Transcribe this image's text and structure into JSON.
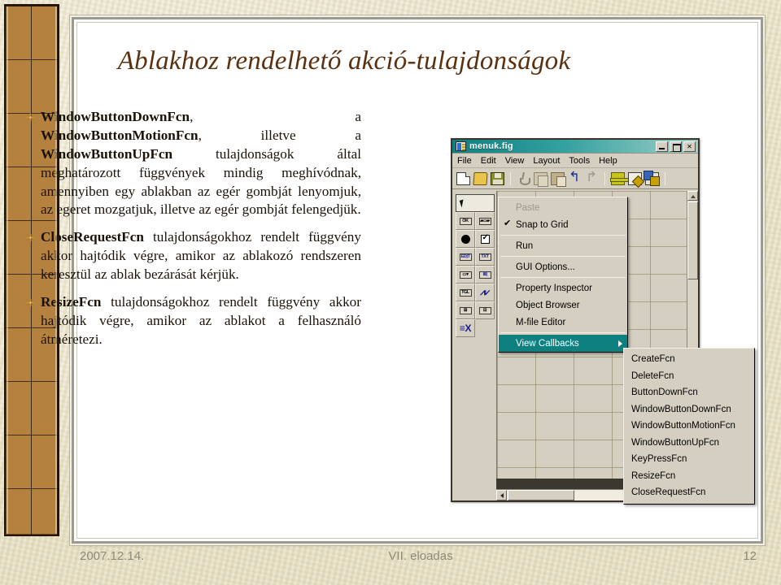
{
  "slide": {
    "title": "Ablakhoz rendelhető akció-tulajdonságok",
    "bullet_glyph": "sunburst-star-bullet"
  },
  "bullets": [
    {
      "id": "bullet-window-button-fcn",
      "lead_bold_1": "WindowButtonDownFcn",
      "lead_bold_2": "WindowButtonMotionFcn",
      "lead_bold_3": "WindowButtonUpFcn",
      "text_a": ", a ",
      "text_b": ", illetve a ",
      "text_c": " tulajdonságok által meghatározott függvények mindig meghívódnak, amennyiben egy ablakban az egér gombját lenyomjuk, az egeret mozgatjuk, illetve az egér gombját felengedjük."
    },
    {
      "id": "bullet-close-request-fcn",
      "lead_bold_1": "CloseRequestFcn",
      "text_c": " tulajdonságokhoz rendelt függvény akkor hajtódik végre, amikor az ablakozó rendszeren keresztül az ablak bezárását kérjük."
    },
    {
      "id": "bullet-resize-fcn",
      "lead_bold_1": "ResizeFcn",
      "text_c": " tulajdonságokhoz rendelt függvény akkor hajtódik végre, amikor az ablakot a felhasználó átméretezi."
    }
  ],
  "footer": {
    "date": "2007.12.14.",
    "center": "VII. eloadas",
    "page": "12"
  },
  "matlab_window": {
    "title": "menuk.fig",
    "window_buttons": {
      "minimize": "_",
      "maximize": "□",
      "close": "✕"
    },
    "menubar": [
      "File",
      "Edit",
      "View",
      "Layout",
      "Tools",
      "Help"
    ],
    "toolbar_icons": [
      "new-file-icon",
      "open-folder-icon",
      "save-disk-icon",
      "cut-scissors-icon",
      "copy-icon",
      "paste-icon",
      "undo-icon",
      "redo-icon",
      "align-objects-icon",
      "menu-editor-icon",
      "m-file-editor-icon"
    ],
    "palette": [
      {
        "name": "pointer-tool",
        "label": ""
      },
      {
        "name": "push-button-tool",
        "label": "OK"
      },
      {
        "name": "slider-tool",
        "label": "▭▭▭"
      },
      {
        "name": "radio-button-tool",
        "label": ""
      },
      {
        "name": "checkbox-tool",
        "label": ""
      },
      {
        "name": "edit-text-tool",
        "label": "EDIT"
      },
      {
        "name": "static-text-tool",
        "label": "TXT"
      },
      {
        "name": "popup-menu-tool",
        "label": "▾"
      },
      {
        "name": "listbox-tool",
        "label": "≡"
      },
      {
        "name": "toggle-button-tool",
        "label": "TGL"
      },
      {
        "name": "axes-tool",
        "label": ""
      },
      {
        "name": "panel-tool",
        "label": ""
      },
      {
        "name": "button-group-tool",
        "label": ""
      },
      {
        "name": "activex-control-tool",
        "label": "X"
      }
    ]
  },
  "context_menu": {
    "items": [
      {
        "label": "Paste",
        "state": "disabled"
      },
      {
        "label": "Snap to Grid",
        "state": "checked"
      },
      {
        "label": "Run",
        "state": "normal"
      },
      {
        "label": "GUI Options...",
        "state": "normal"
      },
      {
        "label": "Property Inspector",
        "state": "normal"
      },
      {
        "label": "Object Browser",
        "state": "normal"
      },
      {
        "label": "M-file Editor",
        "state": "normal"
      },
      {
        "label": "View Callbacks",
        "state": "highlight-submenu"
      }
    ],
    "highlight_color": "#0e8080"
  },
  "callbacks_submenu": {
    "items": [
      "CreateFcn",
      "DeleteFcn",
      "ButtonDownFcn",
      "WindowButtonDownFcn",
      "WindowButtonMotionFcn",
      "WindowButtonUpFcn",
      "KeyPressFcn",
      "ResizeFcn",
      "CloseRequestFcn"
    ]
  },
  "colors": {
    "title": "#5b3211",
    "slide_bg": "#eae3c8",
    "strip": "#b5813f",
    "menu_highlight": "#0e8080",
    "titlebar": "#0f7f7f"
  }
}
